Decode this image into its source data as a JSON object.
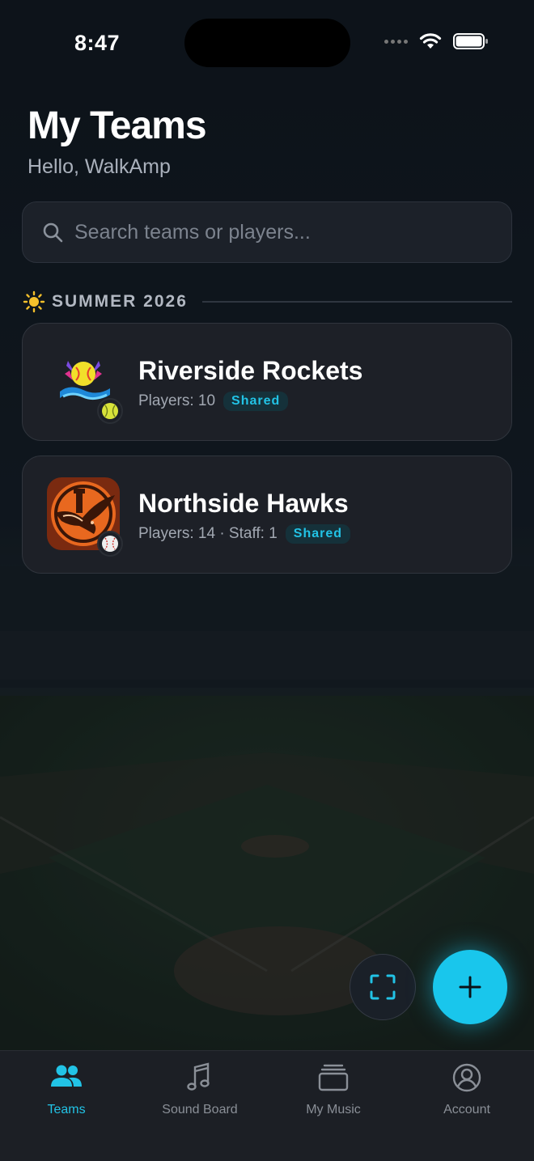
{
  "status_bar": {
    "time": "8:47"
  },
  "header": {
    "title": "My Teams",
    "greeting": "Hello, WalkAmp"
  },
  "search": {
    "placeholder": "Search teams or players...",
    "value": ""
  },
  "section": {
    "label": "SUMMER 2026"
  },
  "teams": [
    {
      "name": "Riverside Rockets",
      "meta": "Players: 10",
      "badge": "Shared",
      "sport_icon": "softball-icon"
    },
    {
      "name": "Northside Hawks",
      "meta": "Players: 14 · Staff: 1",
      "badge": "Shared",
      "sport_icon": "baseball-icon"
    }
  ],
  "fabs": {
    "scan_icon": "scan-icon",
    "add_icon": "plus-icon"
  },
  "tabbar": {
    "items": [
      {
        "label": "Teams",
        "icon": "people-icon",
        "active": true
      },
      {
        "label": "Sound Board",
        "icon": "music-note-icon",
        "active": false
      },
      {
        "label": "My Music",
        "icon": "stack-icon",
        "active": false
      },
      {
        "label": "Account",
        "icon": "person-circle-icon",
        "active": false
      }
    ]
  },
  "colors": {
    "accent": "#19c6ec",
    "card": "#1d2027",
    "background": "#0c1118"
  }
}
